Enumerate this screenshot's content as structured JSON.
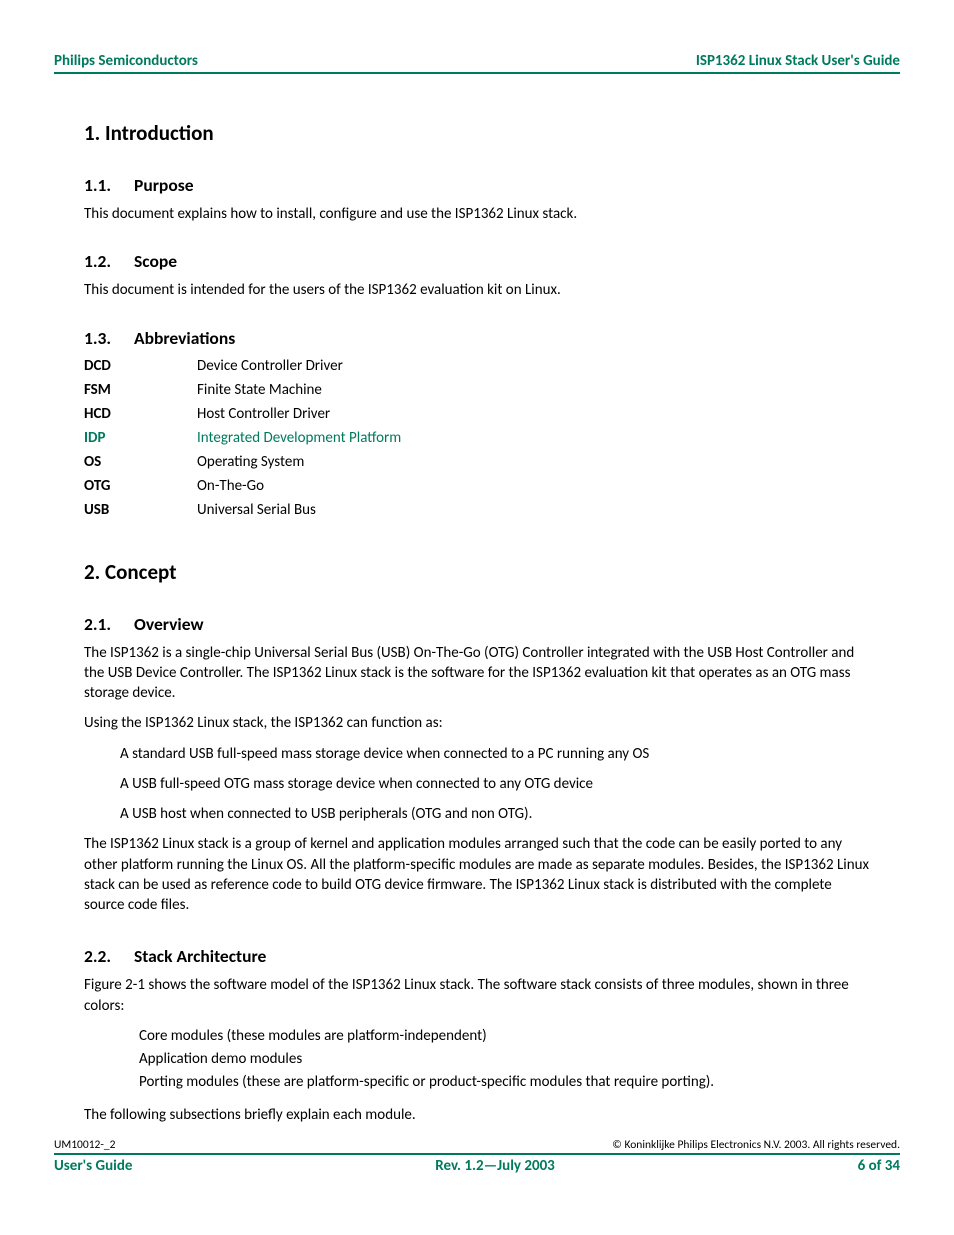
{
  "header": {
    "left": "Philips Semiconductors",
    "right": "ISP1362 Linux Stack User's Guide"
  },
  "s1": {
    "title": "1.  Introduction",
    "s1_1": {
      "num": "1.1.",
      "title": "Purpose",
      "p1": "This document explains how to install, configure and use the ISP1362 Linux stack."
    },
    "s1_2": {
      "num": "1.2.",
      "title": "Scope",
      "p1": "This document is intended for the users of the ISP1362 evaluation kit on Linux."
    },
    "s1_3": {
      "num": "1.3.",
      "title": "Abbreviations",
      "abbr": [
        {
          "term": "DCD",
          "def": "Device Controller Driver"
        },
        {
          "term": "FSM",
          "def": "Finite State Machine"
        },
        {
          "term": "HCD",
          "def": "Host Controller Driver"
        },
        {
          "term": "IDP",
          "def": "Integrated Development Platform",
          "color": "green"
        },
        {
          "term": "OS",
          "def": "Operating System"
        },
        {
          "term": "OTG",
          "def": "On-The-Go"
        },
        {
          "term": "USB",
          "def": "Universal Serial Bus"
        }
      ]
    }
  },
  "s2": {
    "title": "2.  Concept",
    "s2_1": {
      "num": "2.1.",
      "title": "Overview",
      "p1": "The ISP1362 is a single-chip Universal Serial Bus (USB) On-The-Go (OTG) Controller integrated with the USB Host Controller and the USB Device Controller. The ISP1362 Linux stack is the software for the ISP1362 evaluation kit that operates as an OTG mass storage device.",
      "p2": "Using the ISP1362 Linux stack, the ISP1362 can function as:",
      "b1": "A standard USB full-speed mass storage device when connected to a PC running any OS",
      "b2": "A USB full-speed OTG mass storage device when connected to any OTG device",
      "b3": "A USB host when connected to USB peripherals (OTG and non OTG).",
      "p3": "The ISP1362 Linux stack is a group of kernel and application modules arranged such that the code can be easily ported to any other platform running the Linux OS. All the platform-specific modules are made as separate modules. Besides, the ISP1362 Linux stack can be used as reference code to build OTG device firmware. The ISP1362 Linux stack is distributed with the complete source code files."
    },
    "s2_2": {
      "num": "2.2.",
      "title": "Stack Architecture",
      "p1": "Figure 2-1 shows the software model of the ISP1362 Linux stack. The software stack consists of three modules, shown in three colors:",
      "b1": "Core modules (these modules are platform-independent)",
      "b2": "Application demo modules",
      "b3": "Porting modules (these are platform-specific or product-specific modules that require porting).",
      "p2": "The following subsections briefly explain each module."
    }
  },
  "footer": {
    "docid": "UM10012-_2",
    "copyright": "© Koninklijke Philips Electronics N.V. 2003. All rights reserved.",
    "left": "User's Guide",
    "center": "Rev. 1.2—July 2003",
    "right": "6 of 34"
  }
}
